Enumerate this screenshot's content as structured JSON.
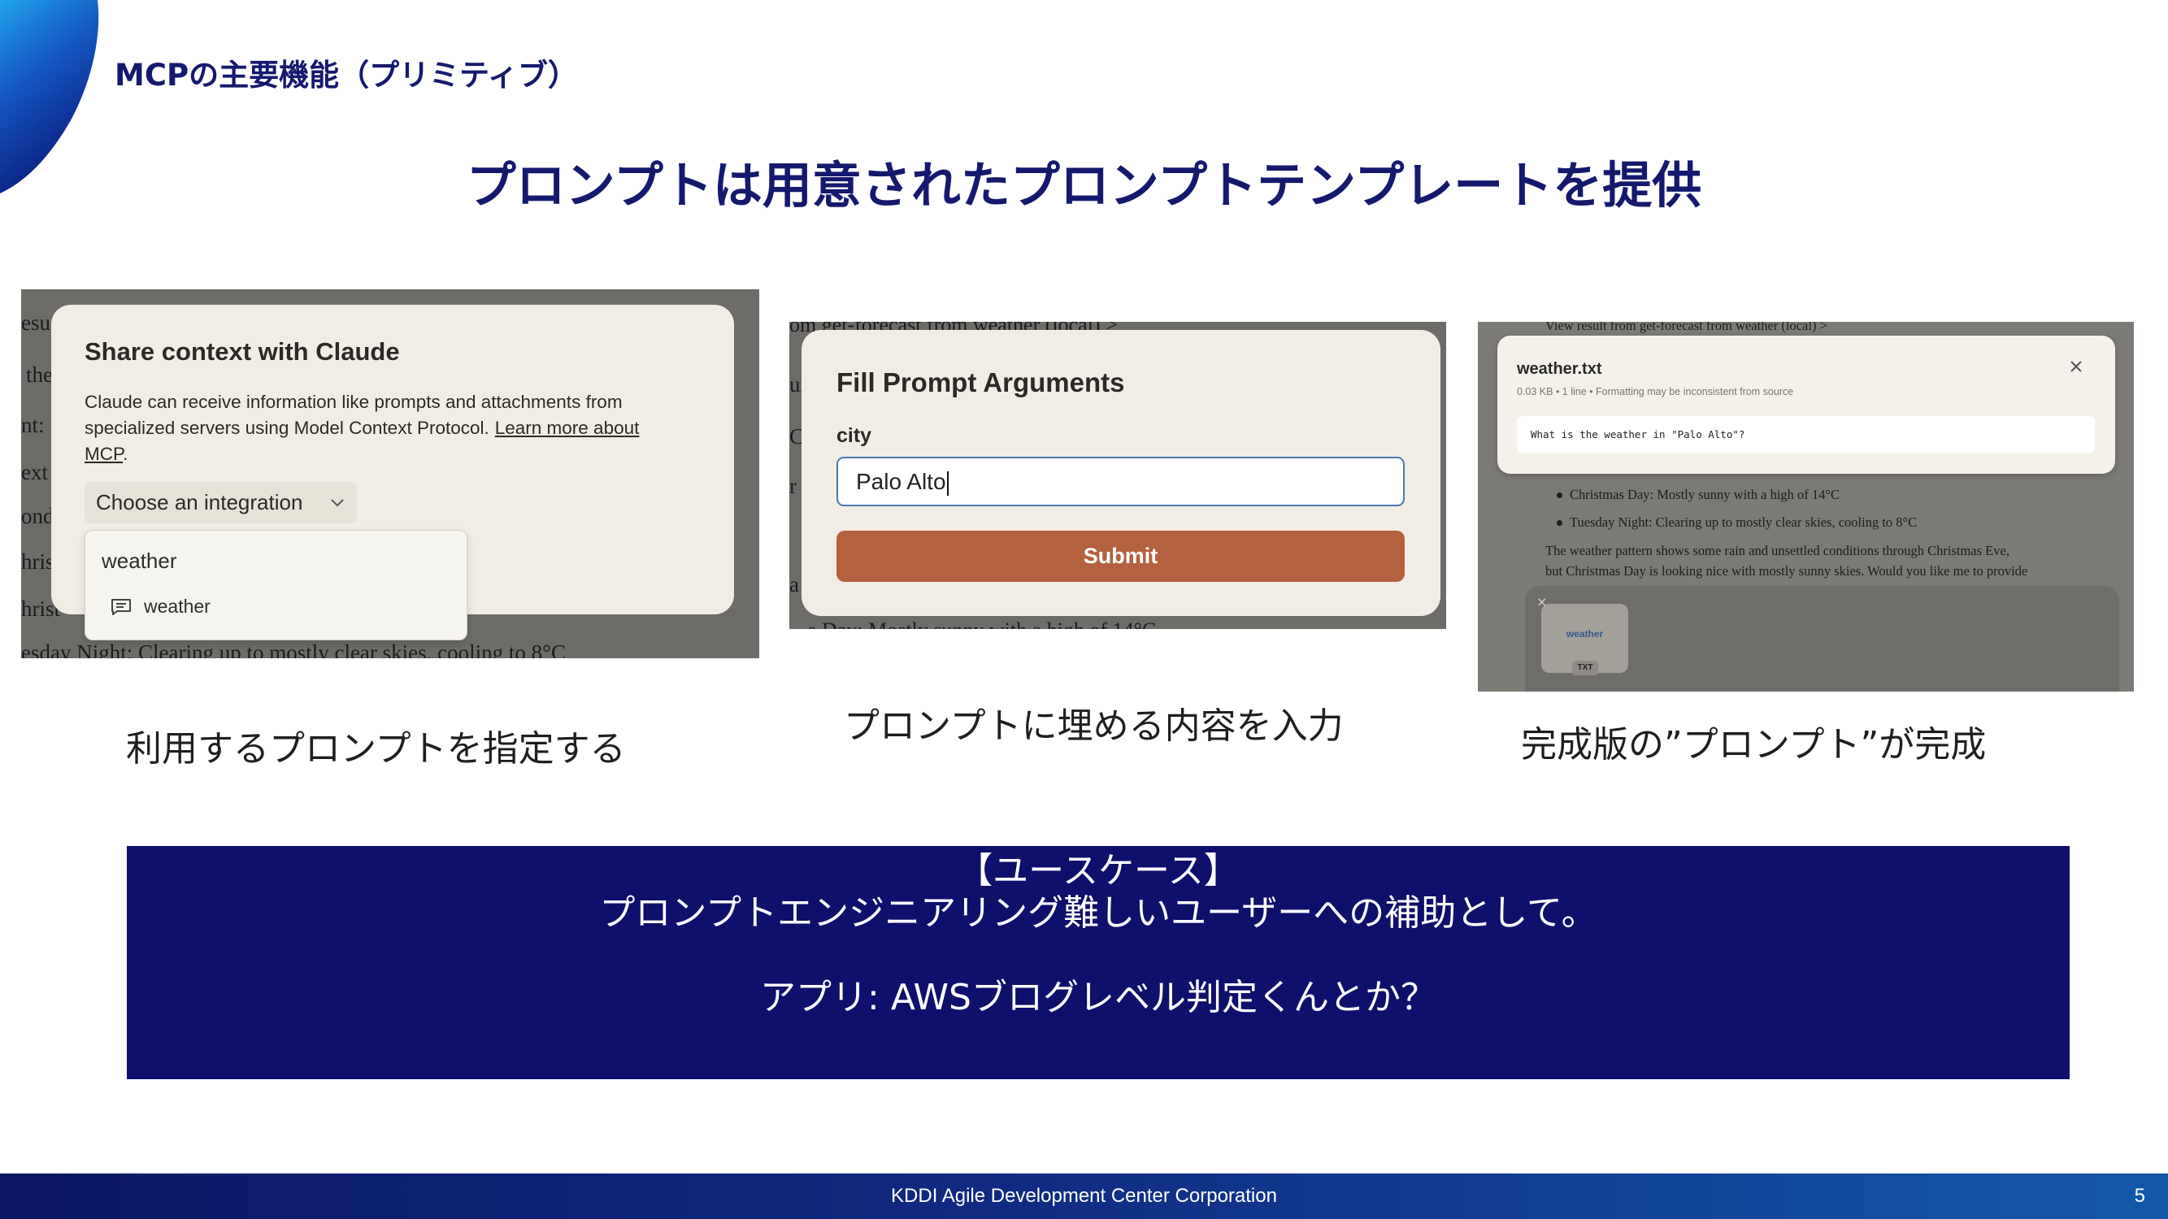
{
  "slide": {
    "section_title": "MCPの主要機能（プリミティブ）",
    "headline": "プロンプトは用意されたプロンプトテンプレートを提供",
    "footer_text": "KDDI Agile Development Center Corporation",
    "page_number": "5"
  },
  "colors": {
    "navy": "#15196e",
    "usecase_bg": "#0f0f6c",
    "submit_bg": "#b4613f",
    "dialog_bg": "#f1ede4",
    "dim_overlay": "#6d6c69"
  },
  "step1": {
    "background_fragments": [
      "esu",
      "the",
      "nt: 1",
      "ext",
      "ond",
      "hris",
      "hrist",
      "esday Night: Clearing up to mostly clear skies, cooling to 8°C"
    ],
    "dialog": {
      "title": "Share context with Claude",
      "body_line1": "Claude can receive information like prompts and attachments from",
      "body_line2": "specialized servers using Model Context Protocol.",
      "link_part1": "Learn more about",
      "link_part2": "MCP",
      "body_end": ".",
      "select_label": "Choose an integration",
      "select_icon": "chevron-down-icon",
      "menu_header": "weather",
      "menu_item": "weather",
      "menu_item_icon": "message-icon"
    },
    "caption": "利用するプロンプトを指定する"
  },
  "step2": {
    "background_top": "om get-forecast from weather (local) >",
    "background_left": [
      "ur",
      "C",
      "r",
      "a"
    ],
    "background_bottom": "e Day: Mostly sunny with a high of 14°C",
    "dialog": {
      "title": "Fill Prompt Arguments",
      "field_label": "city",
      "field_value": "Palo Alto",
      "submit_label": "Submit"
    },
    "caption": "プロンプトに埋める内容を入力"
  },
  "step3": {
    "background_top": "View result from get-forecast from weather (local) >",
    "file": {
      "name": "weather.txt",
      "meta": "0.03 KB • 1 line • Formatting may be inconsistent from source",
      "content": "What is the weather in \"Palo Alto\"?",
      "close_icon": "close-icon"
    },
    "bullets": [
      "Christmas Day: Mostly sunny with a high of 14°C",
      "Tuesday Night: Clearing up to mostly clear skies, cooling to 8°C"
    ],
    "paragraph": [
      "The weather pattern shows some rain and unsettled conditions through Christmas Eve,",
      "but Christmas Day is looking nice with mostly sunny skies. Would you like me to provide"
    ],
    "attachment": {
      "remove_symbol": "×",
      "name": "weather",
      "type": "TXT"
    },
    "caption": "完成版の”プロンプト”が完成"
  },
  "usecase": {
    "heading": "【ユースケース】",
    "line1": "プロンプトエンジニアリング難しいユーザーへの補助として。",
    "line2": "アプリ: AWSブログレベル判定くんとか？"
  }
}
